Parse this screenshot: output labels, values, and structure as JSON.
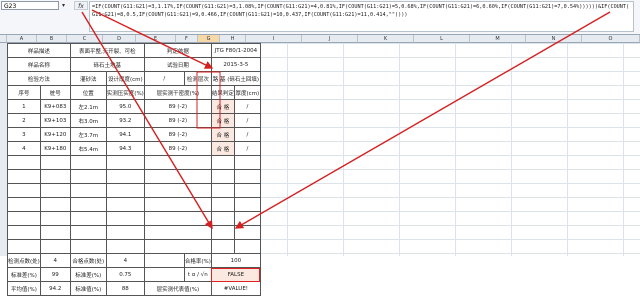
{
  "formula_bar": {
    "cell_ref": "G23",
    "fx": "fx",
    "formula_line1": "=IF(COUNT(G11:G21)=3,1.17%,IF(COUNT(G11:G21)=3,1.08%,IF(COUNT(G11:G21)=4,0.81%,IF(COUNT(G11:G21)=5,0.68%,IF(COUNT(G11:G21)=6,0.60%,IF(COUNT(G11:G21)=7,0.54%))))))&IF(COUNT(",
    "formula_line2": "G11:G21)=8,0.5,IF(COUNT(G11:G21)=9,0.466,IF(COUNT(G11:G21)=10,0.437,IF(COUNT(G11:G21)=11,0.414,\"\"))))"
  },
  "columns": [
    "A",
    "B",
    "C",
    "D",
    "E",
    "F",
    "G",
    "H",
    "I",
    "J",
    "K",
    "L",
    "M",
    "N",
    "O"
  ],
  "sheet": {
    "r1": {
      "a": "样品描述",
      "c": "表面平整,无开裂、可检",
      "e": "判定依据",
      "g": "JTG F80/1-2004"
    },
    "r2": {
      "a": "样品名称",
      "c": "砾石土地基",
      "e": "试验日期",
      "g": "2015-3-5"
    },
    "r3": {
      "a": "检验方法",
      "c": "灌砂法",
      "d": "设计厚度(cm)",
      "e": "/",
      "f": "检测层次",
      "g": "路 基 (砾石土回填)"
    },
    "head": {
      "no": "序号",
      "station": "桩号",
      "position": "位置",
      "density": "实测压实度(%)",
      "dry": "层实测干密度(%)",
      "result": "结果判定",
      "thickness": "厚度(cm)"
    },
    "rows": [
      {
        "no": "1",
        "station": "K9+083",
        "position": "左2.1m",
        "density": "95.0",
        "dry": "89 (-2)",
        "result": "合 格",
        "thickness": "/"
      },
      {
        "no": "2",
        "station": "K9+103",
        "position": "右3.0m",
        "density": "93.2",
        "dry": "89 (-2)",
        "result": "合 格",
        "thickness": "/"
      },
      {
        "no": "3",
        "station": "K9+120",
        "position": "左3.7m",
        "density": "94.1",
        "dry": "89 (-2)",
        "result": "合 格",
        "thickness": "/"
      },
      {
        "no": "4",
        "station": "K9+180",
        "position": "右5.4m",
        "density": "94.3",
        "dry": "89 (-2)",
        "result": "合 格",
        "thickness": "/"
      }
    ],
    "s1": {
      "a": "检测点数(处)",
      "b": "4",
      "c": "合格点数(处)",
      "d": "4",
      "f": "合格率(%)",
      "g": "100"
    },
    "s2": {
      "a": "标准差(%)",
      "b": "99",
      "c": "标准差(%)",
      "d": "0.75",
      "f": "t α / √n",
      "g": "FALSE"
    },
    "s3": {
      "a": "平均值(%)",
      "b": "94.2",
      "c": "标准值(%)",
      "d": "88",
      "e": "层实测代表值(%)",
      "g": "#VALUE!"
    }
  }
}
